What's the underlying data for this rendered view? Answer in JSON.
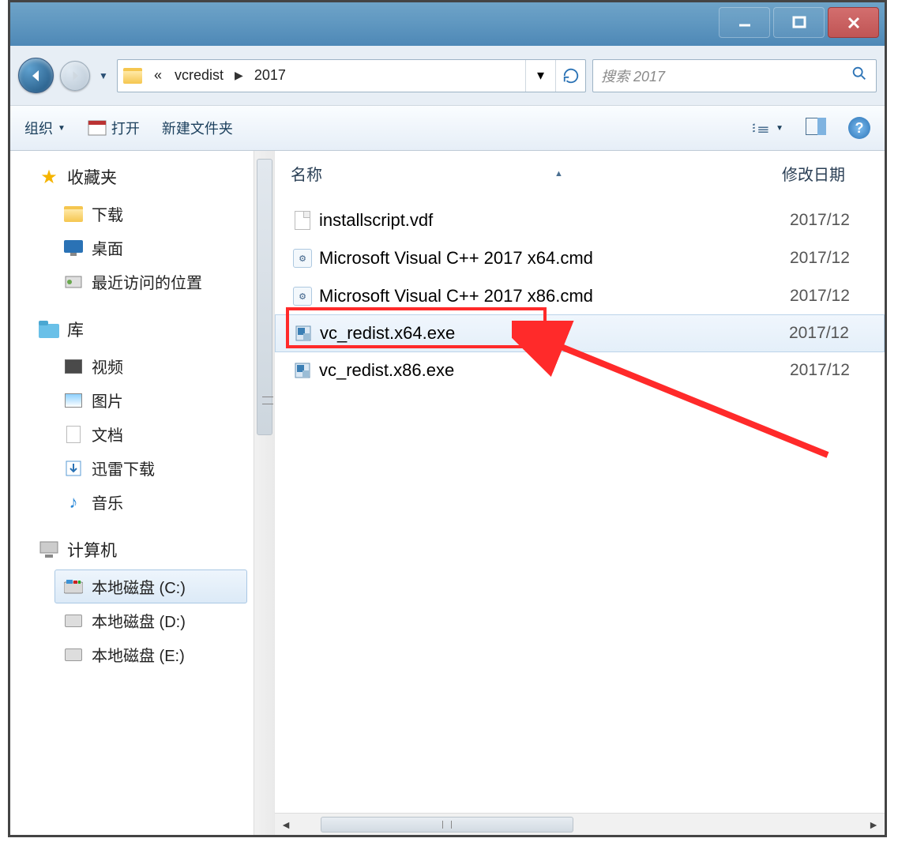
{
  "nav": {
    "crumb_prefix": "«",
    "crumb1": "vcredist",
    "crumb2": "2017",
    "search_placeholder": "搜索 2017"
  },
  "toolbar": {
    "organize": "组织",
    "open": "打开",
    "new_folder": "新建文件夹"
  },
  "columns": {
    "name": "名称",
    "date": "修改日期"
  },
  "sidebar": {
    "favorites": "收藏夹",
    "downloads": "下载",
    "desktop": "桌面",
    "recent": "最近访问的位置",
    "library": "库",
    "videos": "视频",
    "pictures": "图片",
    "documents": "文档",
    "xunlei": "迅雷下载",
    "music": "音乐",
    "computer": "计算机",
    "disk_c": "本地磁盘 (C:)",
    "disk_d": "本地磁盘 (D:)",
    "disk_e": "本地磁盘 (E:)"
  },
  "files": [
    {
      "name": "installscript.vdf",
      "date": "2017/12",
      "type": "file"
    },
    {
      "name": "Microsoft Visual C++ 2017 x64.cmd",
      "date": "2017/12",
      "type": "cmd"
    },
    {
      "name": "Microsoft Visual C++ 2017 x86.cmd",
      "date": "2017/12",
      "type": "cmd"
    },
    {
      "name": "vc_redist.x64.exe",
      "date": "2017/12",
      "type": "exe",
      "selected": true
    },
    {
      "name": "vc_redist.x86.exe",
      "date": "2017/12",
      "type": "exe"
    }
  ]
}
